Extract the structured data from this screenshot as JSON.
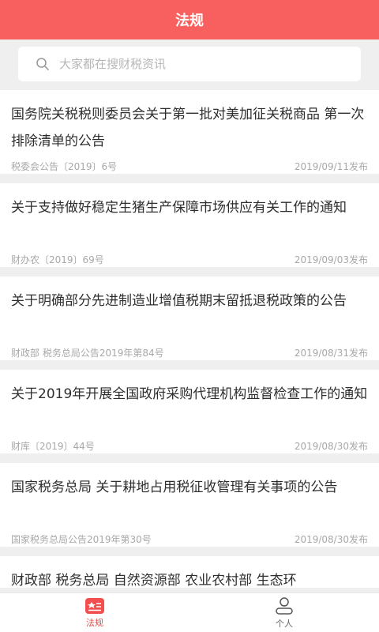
{
  "header": {
    "title": "法规"
  },
  "search": {
    "placeholder": "大家都在搜财税资讯"
  },
  "articles": [
    {
      "title": "国务院关税税则委员会关于第一批对美加征关税商品 第一次排除清单的公告",
      "source": "税委会公告〔2019〕6号",
      "date": "2019/09/11发布"
    },
    {
      "title": "关于支持做好稳定生猪生产保障市场供应有关工作的通知",
      "source": "财办农〔2019〕69号",
      "date": "2019/09/03发布"
    },
    {
      "title": "关于明确部分先进制造业增值税期末留抵退税政策的公告",
      "source": "财政部 税务总局公告2019年第84号",
      "date": "2019/08/31发布"
    },
    {
      "title": "关于2019年开展全国政府采购代理机构监督检查工作的通知",
      "source": "财库〔2019〕44号",
      "date": "2019/08/30发布"
    },
    {
      "title": "国家税务总局 关于耕地占用税征收管理有关事项的公告",
      "source": "国家税务总局公告2019年第30号",
      "date": "2019/08/30发布"
    },
    {
      "title": "财政部 税务总局 自然资源部 农业农村部 生态环"
    }
  ],
  "tabbar": {
    "items": [
      {
        "label": "法规",
        "icon": "law-icon",
        "active": true
      },
      {
        "label": "个人",
        "icon": "person-icon",
        "active": false
      }
    ]
  },
  "colors": {
    "accent": "#f85f5f",
    "background": "#efefef"
  }
}
